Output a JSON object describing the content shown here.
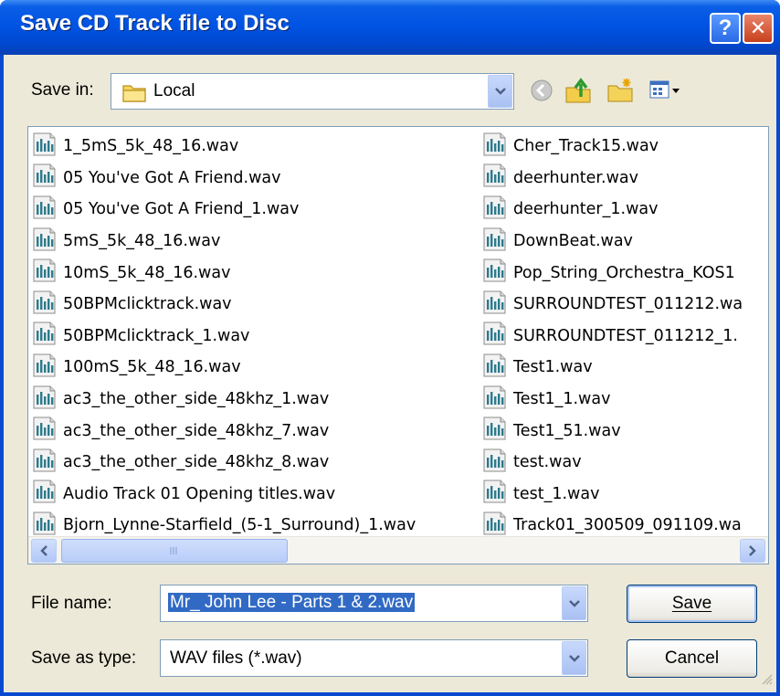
{
  "window": {
    "title": "Save CD Track file to Disc",
    "help_glyph": "?",
    "close_glyph": "✕"
  },
  "save_in": {
    "label": "Save in:",
    "value": "Local",
    "folder_icon": "folder-icon"
  },
  "toolbar": {
    "icons": [
      "back-icon",
      "up-folder-icon",
      "new-folder-icon",
      "view-menu-icon"
    ]
  },
  "files": {
    "icon": "audio-file-icon",
    "column1": [
      "1_5mS_5k_48_16.wav",
      "05 You've Got A Friend.wav",
      "05 You've Got A Friend_1.wav",
      "5mS_5k_48_16.wav",
      "10mS_5k_48_16.wav",
      "50BPMclicktrack.wav",
      "50BPMclicktrack_1.wav",
      "100mS_5k_48_16.wav",
      "ac3_the_other_side_48khz_1.wav",
      "ac3_the_other_side_48khz_7.wav",
      "ac3_the_other_side_48khz_8.wav",
      "Audio Track 01 Opening titles.wav",
      "Bjorn_Lynne-Starfield_(5-1_Surround)_1.wav"
    ],
    "column2": [
      "Cher_Track15.wav",
      "deerhunter.wav",
      "deerhunter_1.wav",
      "DownBeat.wav",
      "Pop_String_Orchestra_KOS1",
      "SURROUNDTEST_011212.wa",
      "SURROUNDTEST_011212_1.",
      "Test1.wav",
      "Test1_1.wav",
      "Test1_51.wav",
      "test.wav",
      "test_1.wav",
      "Track01_300509_091109.wa"
    ]
  },
  "file_name": {
    "label": "File name:",
    "value": "Mr_ John Lee - Parts 1 & 2.wav"
  },
  "save_as_type": {
    "label": "Save as type:",
    "value": "WAV files (*.wav)"
  },
  "buttons": {
    "save": "Save",
    "cancel": "Cancel"
  },
  "colors": {
    "title_bar": "#0054e3",
    "dialog_face": "#ece9d8",
    "selection": "#316ac5",
    "close_button": "#c8401c"
  }
}
